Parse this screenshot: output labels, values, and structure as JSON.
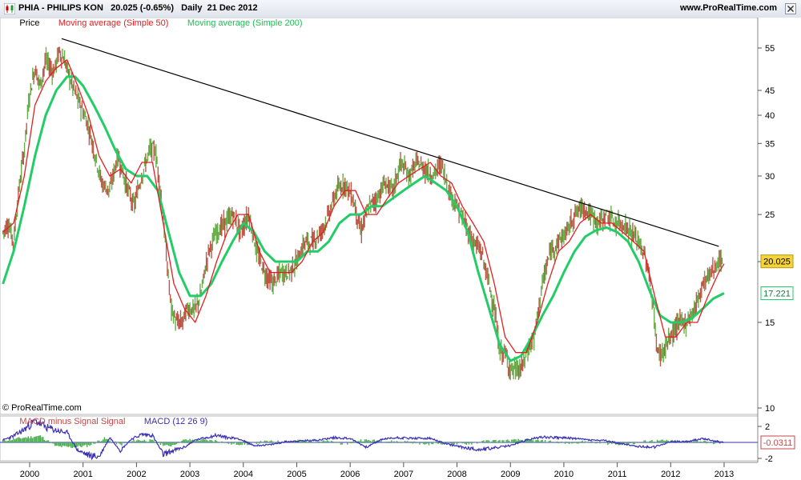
{
  "window": {
    "symbol": "PHIA - PHILIPS KON",
    "quote": "20.025 (-0.65%)",
    "period": "Daily  21 Dec 2012",
    "site": "www.ProRealTime.com",
    "icon": "candlestick-icon",
    "close_icon": "close-icon"
  },
  "legend": {
    "price": "Price",
    "ma50": "Moving average (Simple 50)",
    "ma200": "Moving average (Simple 200)"
  },
  "macd_legend": {
    "signal": "MACD minus Signal Signal",
    "macd": "MACD (12 26 9)"
  },
  "copyright": "© ProRealTime.com",
  "colors": {
    "price": "#4f9a2e",
    "ma50": "#e02020",
    "ma200": "#22cc66",
    "trendline": "#000000",
    "macd": "#3a2fb5",
    "macd_hist": "#4caf50",
    "last_price_bg": "#f5d33a"
  },
  "chart_data": [
    {
      "type": "line",
      "title": "PHIA - PHILIPS KON",
      "scale": "log",
      "y_ticks": [
        10,
        15,
        20,
        25,
        30,
        35,
        40,
        45,
        55
      ],
      "x_ticks": [
        "2000",
        "2001",
        "2002",
        "2003",
        "2004",
        "2005",
        "2006",
        "2007",
        "2008",
        "2009",
        "2010",
        "2011",
        "2012",
        "2013"
      ],
      "ylim": [
        9.6,
        60
      ],
      "last_price_label": "20.025",
      "ma200_label": "17.221",
      "series": [
        {
          "name": "Price",
          "x": [
            1999.5,
            1999.6,
            1999.7,
            1999.8,
            1999.9,
            2000.0,
            2000.1,
            2000.2,
            2000.3,
            2000.45,
            2000.55,
            2000.65,
            2000.8,
            2000.95,
            2001.1,
            2001.2,
            2001.35,
            2001.5,
            2001.65,
            2001.8,
            2001.95,
            2002.1,
            2002.25,
            2002.35,
            2002.45,
            2002.55,
            2002.65,
            2002.75,
            2002.85,
            2002.95,
            2003.1,
            2003.2,
            2003.35,
            2003.5,
            2003.65,
            2003.8,
            2003.95,
            2004.1,
            2004.25,
            2004.4,
            2004.55,
            2004.7,
            2004.85,
            2005.0,
            2005.15,
            2005.3,
            2005.45,
            2005.6,
            2005.75,
            2005.9,
            2006.05,
            2006.2,
            2006.35,
            2006.5,
            2006.65,
            2006.8,
            2006.95,
            2007.1,
            2007.25,
            2007.4,
            2007.55,
            2007.7,
            2007.85,
            2008.0,
            2008.15,
            2008.3,
            2008.45,
            2008.6,
            2008.7,
            2008.8,
            2008.9,
            2009.0,
            2009.1,
            2009.2,
            2009.3,
            2009.45,
            2009.6,
            2009.75,
            2009.9,
            2010.05,
            2010.2,
            2010.35,
            2010.5,
            2010.65,
            2010.8,
            2010.95,
            2011.1,
            2011.25,
            2011.4,
            2011.55,
            2011.65,
            2011.75,
            2011.85,
            2012.0,
            2012.15,
            2012.3,
            2012.45,
            2012.6,
            2012.75,
            2012.9,
            2013.0
          ],
          "values": [
            23,
            24,
            22,
            28,
            34,
            44,
            50,
            46,
            52,
            49,
            54,
            52,
            46,
            42,
            38,
            34,
            29,
            28,
            33,
            29,
            26,
            30,
            34,
            34,
            28,
            21,
            16,
            15,
            15,
            16,
            16,
            17,
            21,
            23,
            24,
            25,
            23,
            25,
            21,
            19,
            18,
            19,
            19,
            20,
            22,
            22,
            23,
            25,
            28,
            29,
            27,
            23,
            26,
            27,
            29,
            28,
            32,
            30,
            32,
            31,
            30,
            32,
            28,
            26,
            24,
            22,
            21,
            18,
            16,
            13,
            13,
            12,
            12,
            12,
            13,
            14,
            18,
            21,
            22,
            23,
            25,
            26,
            25,
            24,
            25,
            24,
            24,
            23,
            22,
            20,
            17,
            13,
            13,
            14,
            15,
            15,
            16,
            18,
            19,
            20,
            20
          ]
        },
        {
          "name": "Moving average (Simple 50)",
          "x": [
            1999.5,
            1999.7,
            1999.9,
            2000.1,
            2000.3,
            2000.5,
            2000.7,
            2000.9,
            2001.1,
            2001.3,
            2001.5,
            2001.7,
            2001.9,
            2002.1,
            2002.3,
            2002.5,
            2002.7,
            2002.9,
            2003.1,
            2003.3,
            2003.5,
            2003.7,
            2003.9,
            2004.1,
            2004.3,
            2004.5,
            2004.7,
            2004.9,
            2005.1,
            2005.3,
            2005.5,
            2005.7,
            2005.9,
            2006.1,
            2006.3,
            2006.5,
            2006.7,
            2006.9,
            2007.1,
            2007.3,
            2007.5,
            2007.7,
            2007.9,
            2008.1,
            2008.3,
            2008.5,
            2008.7,
            2008.9,
            2009.1,
            2009.3,
            2009.5,
            2009.7,
            2009.9,
            2010.1,
            2010.3,
            2010.5,
            2010.7,
            2010.9,
            2011.1,
            2011.3,
            2011.5,
            2011.7,
            2011.9,
            2012.1,
            2012.3,
            2012.5,
            2012.7,
            2012.9,
            2013.0
          ],
          "values": [
            23,
            24,
            30,
            42,
            47,
            50,
            52,
            46,
            40,
            33,
            30,
            31,
            29,
            32,
            32,
            24,
            18,
            16,
            15,
            17,
            20,
            23,
            25,
            25,
            21,
            19,
            19,
            19,
            20,
            22,
            23,
            26,
            28,
            28,
            25,
            25,
            27,
            29,
            30,
            31,
            32,
            30,
            29,
            26,
            24,
            22,
            18,
            14,
            13,
            13,
            15,
            18,
            21,
            22,
            24,
            25,
            24,
            24,
            23,
            22,
            21,
            17,
            14,
            14,
            15,
            15,
            17,
            19,
            19.8
          ]
        },
        {
          "name": "Moving average (Simple 200)",
          "x": [
            1999.5,
            1999.7,
            1999.9,
            2000.1,
            2000.3,
            2000.5,
            2000.7,
            2000.85,
            2001.0,
            2001.2,
            2001.4,
            2001.6,
            2001.8,
            2002.0,
            2002.2,
            2002.4,
            2002.6,
            2002.8,
            2003.0,
            2003.2,
            2003.4,
            2003.6,
            2003.8,
            2004.0,
            2004.2,
            2004.4,
            2004.6,
            2004.8,
            2005.0,
            2005.2,
            2005.4,
            2005.6,
            2005.8,
            2006.0,
            2006.2,
            2006.4,
            2006.6,
            2006.8,
            2007.0,
            2007.2,
            2007.4,
            2007.6,
            2007.8,
            2008.0,
            2008.2,
            2008.4,
            2008.6,
            2008.8,
            2009.0,
            2009.2,
            2009.4,
            2009.6,
            2009.8,
            2010.0,
            2010.2,
            2010.4,
            2010.6,
            2010.8,
            2011.0,
            2011.2,
            2011.4,
            2011.6,
            2011.8,
            2012.0,
            2012.2,
            2012.4,
            2012.6,
            2012.8,
            2013.0
          ],
          "values": [
            18,
            21,
            26,
            33,
            40,
            45,
            48,
            48,
            46,
            42,
            38,
            34,
            31,
            30,
            30,
            28,
            23,
            19,
            17,
            17,
            18,
            20,
            22,
            24,
            23,
            21,
            20,
            20,
            20,
            21,
            21,
            22,
            24,
            25,
            25,
            26,
            26,
            27,
            28,
            29,
            30,
            29,
            28,
            26,
            23,
            19,
            16,
            13.5,
            12.5,
            12.8,
            14,
            15.5,
            17,
            19,
            21,
            22.5,
            23.2,
            23.5,
            23,
            22,
            20,
            17.5,
            15.5,
            15,
            15,
            15.3,
            16,
            16.8,
            17.221
          ]
        },
        {
          "name": "Trend line",
          "x": [
            2000.6,
            2012.9
          ],
          "values": [
            57.5,
            21.5
          ]
        }
      ]
    },
    {
      "type": "line",
      "title": "MACD (12 26 9)",
      "y_ticks": [
        2,
        -2
      ],
      "ylim": [
        -3,
        3
      ],
      "last_value_label": "-0.0311",
      "series": [
        {
          "name": "MACD (12 26 9)",
          "x": [
            1999.5,
            1999.7,
            1999.9,
            2000.1,
            2000.3,
            2000.5,
            2000.7,
            2000.9,
            2001.1,
            2001.3,
            2001.5,
            2001.7,
            2001.9,
            2002.1,
            2002.3,
            2002.5,
            2002.7,
            2002.9,
            2003.1,
            2003.3,
            2003.5,
            2003.7,
            2003.9,
            2004.2,
            2004.5,
            2004.8,
            2005.1,
            2005.4,
            2005.7,
            2006.0,
            2006.3,
            2006.6,
            2006.9,
            2007.2,
            2007.5,
            2007.8,
            2008.1,
            2008.4,
            2008.7,
            2009.0,
            2009.3,
            2009.6,
            2009.9,
            2010.2,
            2010.5,
            2010.8,
            2011.1,
            2011.4,
            2011.7,
            2012.0,
            2012.3,
            2012.6,
            2012.9,
            2013.0
          ],
          "values": [
            0.3,
            0.8,
            1.6,
            2.8,
            1.9,
            1.5,
            1.2,
            -1.0,
            -1.6,
            -1.8,
            0.6,
            -1.0,
            0.4,
            1.0,
            0.9,
            -1.5,
            -1.0,
            -0.6,
            0.3,
            0.6,
            0.9,
            0.6,
            0.5,
            -0.4,
            -0.3,
            0.1,
            0.2,
            0.3,
            0.6,
            0.5,
            -0.6,
            0.4,
            0.6,
            0.5,
            0.5,
            -0.2,
            -0.6,
            -0.9,
            -0.7,
            -0.4,
            0.3,
            0.7,
            0.6,
            0.5,
            0.3,
            0.2,
            -0.2,
            -0.5,
            -0.6,
            0.1,
            0.1,
            0.5,
            0.1,
            -0.0311
          ]
        },
        {
          "name": "MACD minus Signal Signal",
          "x": [
            1999.6,
            1999.9,
            2000.2,
            2000.5,
            2000.8,
            2001.1,
            2001.4,
            2001.7,
            2002.0,
            2002.3,
            2002.6,
            2002.9,
            2003.2,
            2003.5,
            2003.8,
            2004.1,
            2004.4,
            2004.7,
            2005.0,
            2005.3,
            2005.6,
            2005.9,
            2006.2,
            2006.5,
            2006.8,
            2007.1,
            2007.4,
            2007.7,
            2008.0,
            2008.3,
            2008.6,
            2008.9,
            2009.2,
            2009.5,
            2009.8,
            2010.1,
            2010.4,
            2010.7,
            2011.0,
            2011.3,
            2011.6,
            2011.9,
            2012.2,
            2012.5,
            2012.8
          ],
          "values": [
            0.3,
            0.6,
            0.8,
            -0.5,
            -0.6,
            -0.4,
            0.5,
            -0.3,
            0.3,
            0.2,
            -0.5,
            0.3,
            0.3,
            0.2,
            -0.2,
            -0.2,
            0.1,
            0.1,
            0.2,
            0.2,
            0.1,
            -0.2,
            0.3,
            0.2,
            0.1,
            0.1,
            -0.2,
            -0.1,
            -0.2,
            -0.1,
            0.2,
            0.2,
            0.3,
            0.2,
            0.1,
            -0.1,
            0.1,
            -0.1,
            -0.2,
            -0.1,
            0.2,
            0.2,
            0.1,
            0.2,
            -0.1
          ]
        }
      ]
    }
  ]
}
